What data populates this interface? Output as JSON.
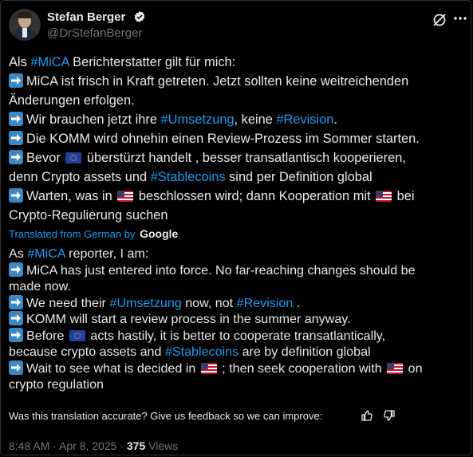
{
  "author": {
    "name": "Stefan Berger",
    "handle": "@DrStefanBerger"
  },
  "icons": {
    "verified": "verified-badge-icon",
    "grok": "grok-icon",
    "more": "more-options-icon",
    "arrow": "right-arrow-emoji-icon",
    "thumbs_up": "thumbs-up-icon",
    "thumbs_down": "thumbs-down-icon"
  },
  "colors": {
    "accent": "#1d9bf0",
    "background": "#000000",
    "text": "#e7e9ea",
    "muted": "#71767b"
  },
  "original": {
    "intro_pre": "Als ",
    "intro_tag": "#MiCA",
    "intro_post": " Berichterstatter gilt für mich:",
    "p1_a": "MiCA ist frisch in Kraft getreten. Jetzt sollten keine weitreichenden",
    "p1_b": "Änderungen erfolgen.",
    "p2_pre": "Wir brauchen jetzt ihre ",
    "p2_tag1": "#Umsetzung",
    "p2_mid": ", keine ",
    "p2_tag2": "#Revision",
    "p2_post": ".",
    "p3": "Die KOMM wird ohnehin einen Review-Prozess im Sommer starten.",
    "p4_pre": "Bevor ",
    "p4_post": " überstürzt handelt , besser transatlantisch kooperieren,",
    "p4_b_pre": "denn Crypto assets und ",
    "p4_b_tag": "#Stablecoins",
    "p4_b_post": " sind per Definition global",
    "p5_pre": "Warten, was in ",
    "p5_mid": " beschlossen wird; dann Kooperation mit ",
    "p5_post": " bei",
    "p5_b": "Crypto-Regulierung suchen"
  },
  "translation_label": "Translated from German by",
  "translation_provider": "Google",
  "translated": {
    "intro_pre": "As ",
    "intro_tag": "#MiCA",
    "intro_post": " reporter, I am:",
    "p1_a": "MiCA has just entered into force. No far-reaching changes should be",
    "p1_b": "made now.",
    "p2_pre": "We need their ",
    "p2_tag1": "#Umsetzung",
    "p2_mid": " now, not ",
    "p2_tag2": "#Revision",
    "p2_post": " .",
    "p3": "KOMM will start a review process in the summer anyway.",
    "p4_pre": "Before ",
    "p4_post": " acts hastily, it is better to cooperate transatlantically,",
    "p4_b_pre": "because crypto assets and ",
    "p4_b_tag": "#Stablecoins",
    "p4_b_post": " are by definition global",
    "p5_pre": "Wait to see what is decided in ",
    "p5_mid": " ; then seek cooperation with ",
    "p5_post": " on",
    "p5_b": "crypto regulation"
  },
  "feedback_prompt": "Was this translation accurate? Give us feedback so we can improve:",
  "meta": {
    "time": "8:48 AM · Apr 8, 2025 · ",
    "views_count": "375",
    "views_label": " Views"
  }
}
